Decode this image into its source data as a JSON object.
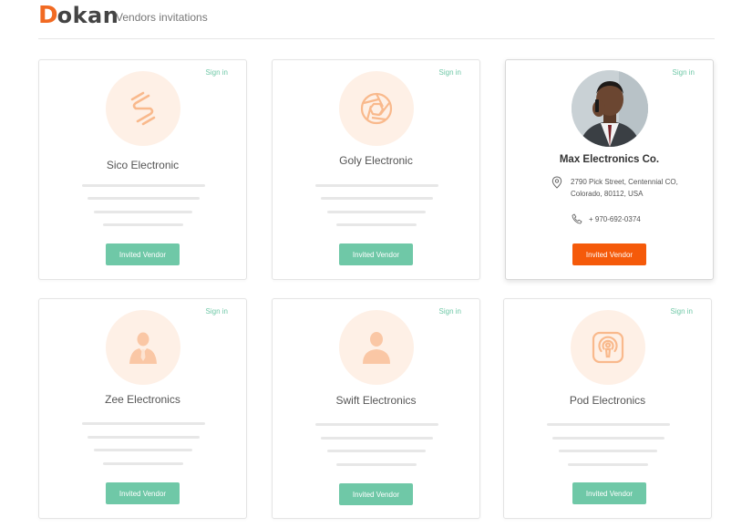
{
  "header": {
    "logo_initial": "D",
    "logo_rest": "okan",
    "title": "Vendors invitations"
  },
  "colors": {
    "brand_orange": "#f16a22",
    "accent_green": "#6fc8a7",
    "active_orange": "#f55a0a",
    "icon_orange": "#fac7a5",
    "icon_bg": "#fef0e6"
  },
  "vendors": [
    {
      "name": "Sico Electronic",
      "sign_in_label": "Sign in",
      "button_label": "Invited Vendor",
      "icon": "sico-logo-icon"
    },
    {
      "name": "Goly Electronic",
      "sign_in_label": "Sign in",
      "button_label": "Invited Vendor",
      "icon": "aperture-icon"
    },
    {
      "name": "Max Electronics Co.",
      "sign_in_label": "Sign in",
      "button_label": "Invited Vendor",
      "icon": "vendor-photo",
      "address": "2790 Pick Street, Centennial CO, Colorado, 80112, USA",
      "phone": "+ 970-692-0374",
      "active": true
    },
    {
      "name": "Zee Electronics",
      "sign_in_label": "Sign in",
      "button_label": "Invited Vendor",
      "icon": "businessman-icon"
    },
    {
      "name": "Swift Electronics",
      "sign_in_label": "Sign in",
      "button_label": "Invited Vendor",
      "icon": "user-icon"
    },
    {
      "name": "Pod Electronics",
      "sign_in_label": "Sign in",
      "button_label": "Invited Vendor",
      "icon": "podcast-icon"
    }
  ]
}
